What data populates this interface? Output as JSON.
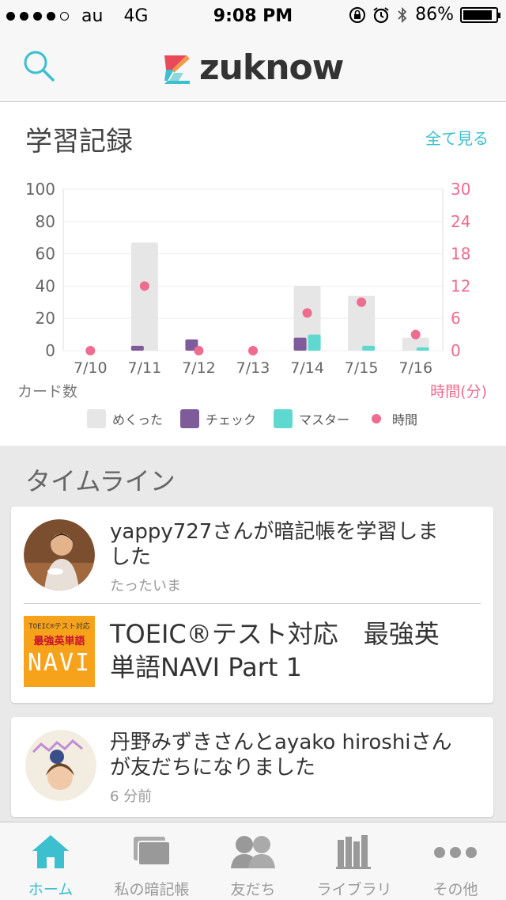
{
  "status": {
    "carrier": "au",
    "network": "4G",
    "time": "9:08 PM",
    "battery": "86%",
    "battery_level": 0.86
  },
  "header": {
    "logo_text": "zuknow",
    "search_icon": "search-icon"
  },
  "record": {
    "title": "学習記録",
    "view_all": "全て見る",
    "left_axis_caption": "カード数",
    "right_axis_caption": "時間(分)"
  },
  "chart_data": {
    "type": "bar",
    "categories": [
      "7/10",
      "7/11",
      "7/12",
      "7/13",
      "7/14",
      "7/15",
      "7/16"
    ],
    "series": [
      {
        "name": "めくった",
        "values": [
          0,
          67,
          0,
          0,
          40,
          34,
          8
        ],
        "color": "#e6e6e6"
      },
      {
        "name": "チェック",
        "values": [
          0,
          3,
          7,
          0,
          8,
          0,
          0
        ],
        "color": "#7f5c99"
      },
      {
        "name": "マスター",
        "values": [
          0,
          0,
          0,
          0,
          10,
          3,
          2
        ],
        "color": "#5fd9d0"
      },
      {
        "name": "時間",
        "type": "scatter",
        "axis": "right",
        "values": [
          0,
          12,
          0,
          0,
          7,
          9,
          3
        ],
        "color": "#ee6c8f"
      }
    ],
    "ylim": [
      0,
      100
    ],
    "y_ticks": [
      "100",
      "80",
      "60",
      "40",
      "20",
      "0"
    ],
    "y2lim": [
      0,
      30
    ],
    "y2_ticks": [
      "30",
      "24",
      "18",
      "12",
      "6",
      "0"
    ],
    "legend": [
      "めくった",
      "チェック",
      "マスター",
      "時間"
    ],
    "legend_position": "bottom"
  },
  "timeline": {
    "title": "タイムライン",
    "items": [
      {
        "text": "yappy727さんが暗記帳を学習しました",
        "text_line1": "yappy727さんが暗記帳を学習しま",
        "text_line2": "した",
        "time": "たったいま",
        "book": {
          "cover_line1": "TOEIC®テスト対応",
          "cover_line2": "最強英単語",
          "cover_line3": "NAVI",
          "title_line1": "TOEIC®テスト対応　最強英",
          "title_line2": "単語NAVI Part 1"
        }
      },
      {
        "text_line1": "丹野みずきさんとayako hiroshiさん",
        "text_line2": "が友だちになりました",
        "time": "6 分前"
      }
    ]
  },
  "tabs": [
    {
      "label": "ホーム",
      "icon": "home-icon",
      "active": true
    },
    {
      "label": "私の暗記帳",
      "icon": "cards-icon",
      "active": false
    },
    {
      "label": "友だち",
      "icon": "friends-icon",
      "active": false
    },
    {
      "label": "ライブラリ",
      "icon": "library-icon",
      "active": false
    },
    {
      "label": "その他",
      "icon": "more-icon",
      "active": false
    }
  ],
  "colors": {
    "accent": "#3cbfcf",
    "pink": "#ee6c8f"
  }
}
